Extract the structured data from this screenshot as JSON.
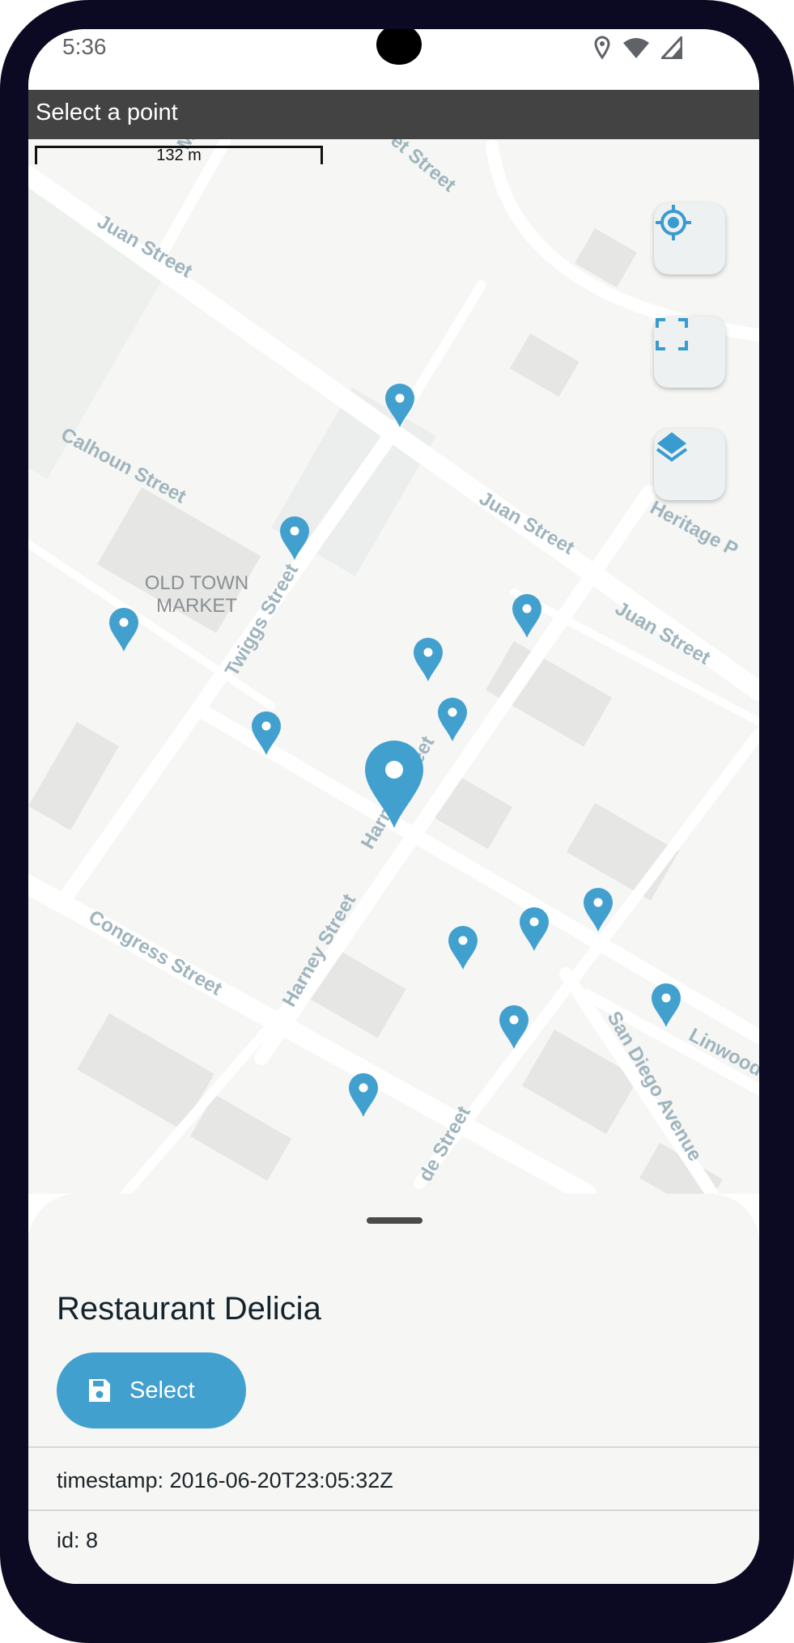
{
  "status_bar": {
    "time": "5:36",
    "icons": [
      "location-icon",
      "wifi-icon",
      "signal-icon"
    ]
  },
  "app_bar": {
    "title": "Select a point"
  },
  "map": {
    "scale_label": "132 m",
    "labels": {
      "juan1": "Juan Street",
      "juan2": "Juan Street",
      "juan3": "Juan Street",
      "calhoun": "Calhoun Street",
      "twiggs": "Twiggs Street",
      "oldtown1": "OLD TOWN",
      "oldtown2": "MARKET",
      "harney1": "Harney Street",
      "harney2": "Harney Street",
      "congress": "Congress Street",
      "sandiego": "San Diego Avenue",
      "linwood": "Linwood",
      "heritage": "Heritage P",
      "street_top": "et Street",
      "ma": "Ma",
      "de_street": "de Street"
    },
    "controls": [
      "locate-icon",
      "fullscreen-icon",
      "layers-icon"
    ],
    "pin_color": "#42a0cf"
  },
  "sheet": {
    "title": "Restaurant Delicia",
    "select_label": "Select",
    "properties": [
      "timestamp: 2016-06-20T23:05:32Z",
      "id: 8"
    ]
  },
  "colors": {
    "accent": "#42a0cf",
    "app_bar": "#434343",
    "frame": "#0b0a22"
  }
}
